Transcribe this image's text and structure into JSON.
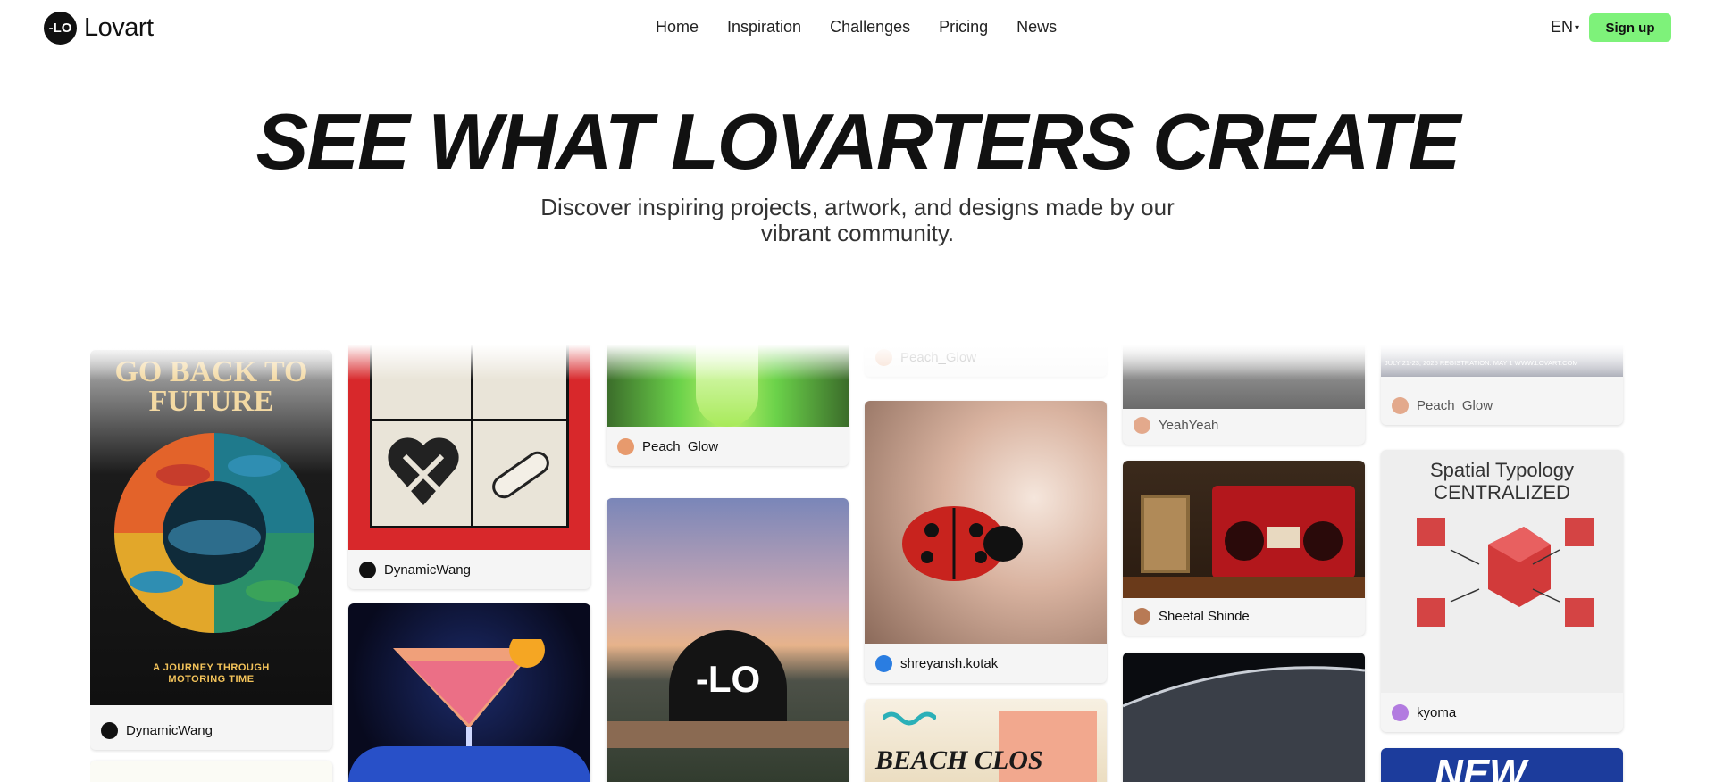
{
  "brand": {
    "name": "Lovart",
    "mark": "-LO"
  },
  "nav": {
    "items": [
      "Home",
      "Inspiration",
      "Challenges",
      "Pricing",
      "News"
    ]
  },
  "header": {
    "language": "EN",
    "signup_label": "Sign up"
  },
  "hero": {
    "title": "SEE WHAT LOVARTERS CREATE",
    "subtitle": "Discover inspiring projects, artwork, and designs made by our vibrant community."
  },
  "colors": {
    "accent": "#7ef27a",
    "text": "#111111"
  },
  "cards": [
    {
      "author": "DynamicWang",
      "art_title": "GO BACK TO FUTURE",
      "art_caption": "A JOURNEY THROUGH MOTORING TIME"
    },
    {
      "author": "DynamicWang"
    },
    {
      "author": "Peach_Glow"
    },
    {
      "author": "Peach_Glow"
    },
    {
      "author": "shreyansh.kotak"
    },
    {
      "author": "YeahYeah"
    },
    {
      "author": "Sheetal Shinde"
    },
    {
      "author": "Peach_Glow",
      "art_caption": "JULY 21-23, 2025  REGISTRATION: MAY 1  WWW.LOVART.COM"
    },
    {
      "author": "kyoma",
      "art_title": "Spatial Typology CENTRALIZED"
    },
    {
      "art_title": "BEACH CLOS"
    },
    {
      "art_title": "NEW"
    }
  ]
}
